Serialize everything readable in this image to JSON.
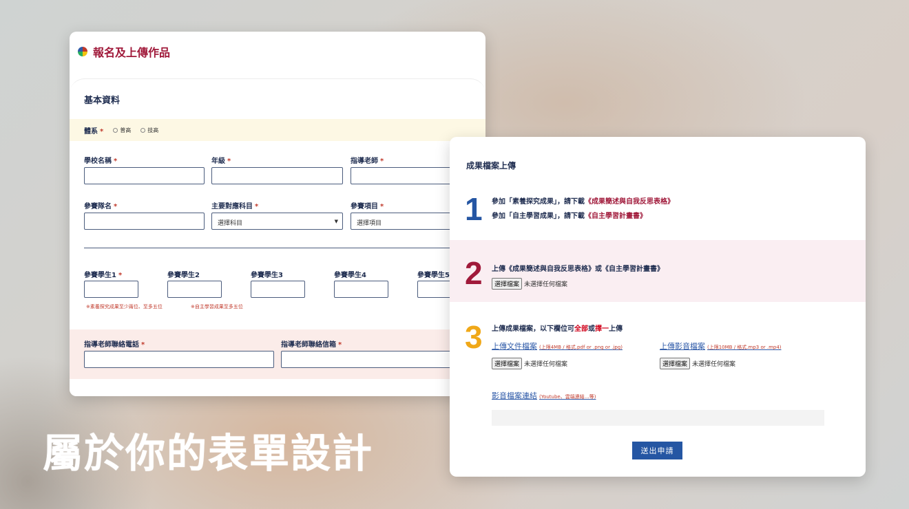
{
  "card1": {
    "title": "報名及上傳作品",
    "section_title": "基本資料",
    "system": {
      "label": "體系",
      "required": "*",
      "options": [
        "普高",
        "技高"
      ]
    },
    "fields_row1": [
      {
        "label": "學校名稱",
        "required": "*"
      },
      {
        "label": "年級",
        "required": "*"
      },
      {
        "label": "指導老師",
        "required": "*"
      }
    ],
    "fields_row2": [
      {
        "label": "參賽隊名",
        "required": "*"
      },
      {
        "label": "主要對應科目",
        "required": "*",
        "value": "選擇科目"
      },
      {
        "label": "參賽項目",
        "required": "*",
        "value": "選擇項目"
      }
    ],
    "students": [
      {
        "label": "參賽學生1",
        "required": "*"
      },
      {
        "label": "參賽學生2"
      },
      {
        "label": "參賽學生3"
      },
      {
        "label": "參賽學生4"
      },
      {
        "label": "參賽學生5"
      }
    ],
    "notes": [
      "※素養探究成果至少兩位、至多五位",
      "※自主學習成果至多五位"
    ],
    "contact": [
      {
        "label": "指導老師聯絡電話",
        "required": "*"
      },
      {
        "label": "指導老師聯絡信箱",
        "required": "*"
      }
    ]
  },
  "card2": {
    "title": "成果檔案上傳",
    "step1": {
      "number": "1",
      "line1_prefix": "參加「素養探究成果」，請下載",
      "line1_link": "《成果簡述與自我反思表格》",
      "line2_prefix": "參加「自主學習成果」，請下載",
      "line2_link": "《自主學習計畫書》"
    },
    "step2": {
      "number": "2",
      "text": "上傳《成果簡述與自我反思表格》或《自主學習計畫書》",
      "file_button": "選擇檔案",
      "file_status": "未選擇任何檔案"
    },
    "step3": {
      "number": "3",
      "text_a": "上傳成果檔案，以下欄位可",
      "text_b": "全部",
      "text_c": "或",
      "text_d": "擇一",
      "text_e": "上傳",
      "doc_link": "上傳文件檔案",
      "doc_note": "(上限4MB / 格式.pdf or .png or .jpg)",
      "video_link": "上傳影音檔案",
      "video_note": "(上限10MB / 格式.mp3 or .mp4)",
      "file_button": "選擇檔案",
      "file_status": "未選擇任何檔案",
      "url_link": "影音檔案連結",
      "url_note": "(Youtube、雲端連結…等)"
    },
    "submit_label": "送出申請"
  },
  "headline": "屬於你的表單設計",
  "colors": {
    "brand_red": "#a0193a",
    "navy": "#1f2d50",
    "step1": "#2556a3",
    "step2": "#a0193a",
    "step3": "#f0a818",
    "submit": "#2556a3"
  }
}
